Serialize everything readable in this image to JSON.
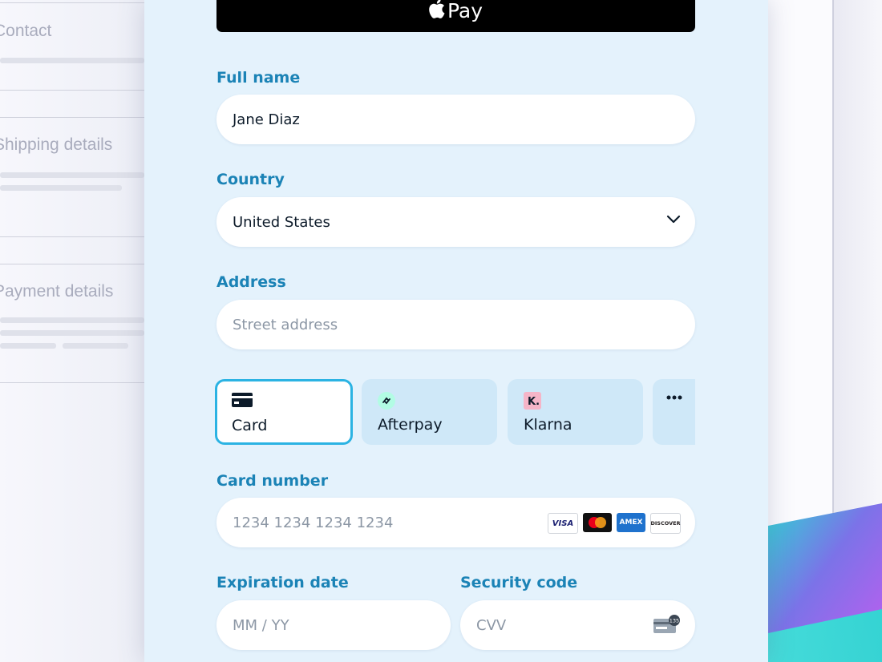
{
  "background": {
    "sections": [
      {
        "title": "Contact"
      },
      {
        "title": "Shipping details"
      },
      {
        "title": "Payment details"
      }
    ]
  },
  "apple_pay": {
    "label": "Pay",
    "logo_icon": "apple-logo-icon"
  },
  "form": {
    "full_name": {
      "label": "Full name",
      "value": "Jane Diaz"
    },
    "country": {
      "label": "Country",
      "value": "United States",
      "icon": "chevron-down-icon"
    },
    "address": {
      "label": "Address",
      "placeholder": "Street address"
    },
    "payment_methods": [
      {
        "label": "Card",
        "icon": "credit-card-icon",
        "selected": true
      },
      {
        "label": "Afterpay",
        "icon": "afterpay-logo-icon",
        "selected": false
      },
      {
        "label": "Klarna",
        "icon": "klarna-logo-icon",
        "selected": false
      },
      {
        "label": "",
        "icon": "more-horizontal-icon",
        "selected": false
      }
    ],
    "card_number": {
      "label": "Card number",
      "placeholder": "1234 1234 1234 1234",
      "brands": [
        "VISA",
        "Mastercard",
        "AMEX",
        "DISCOVER"
      ]
    },
    "expiration": {
      "label": "Expiration date",
      "placeholder": "MM / YY"
    },
    "security": {
      "label": "Security code",
      "placeholder": "CVV",
      "icon": "cvv-card-icon",
      "badge": "135"
    }
  },
  "colors": {
    "accent": "#2bb3e3",
    "label": "#1b83b6",
    "panel_bg": "#e4f2fc",
    "tab_bg": "#cfe8f8"
  }
}
